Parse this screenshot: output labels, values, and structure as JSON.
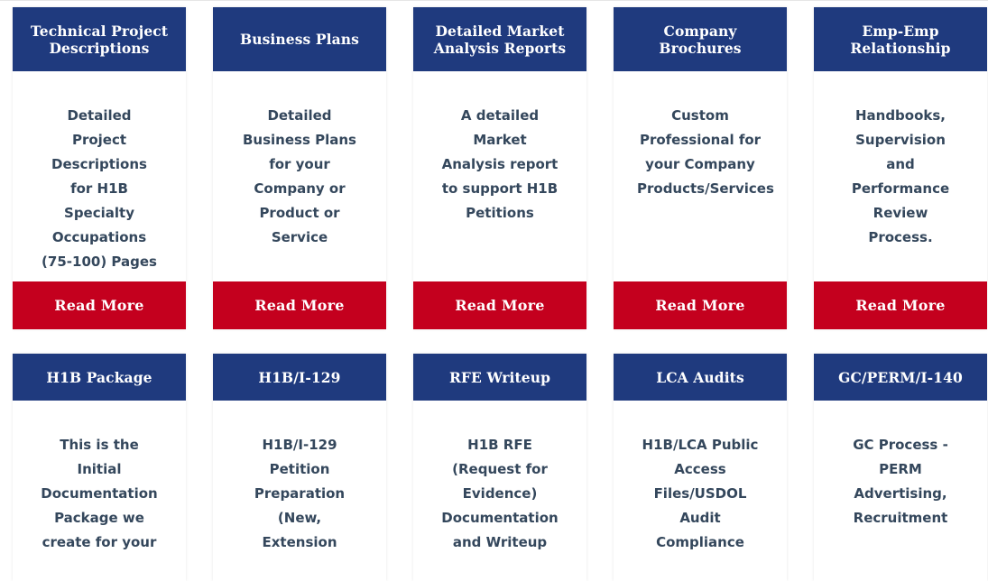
{
  "cards_row1": [
    {
      "title": "Technical Project Descriptions",
      "body": "Detailed Project Descriptions for H1B Specialty Occupations (75-100) Pages",
      "button": "Read More"
    },
    {
      "title": "Business Plans",
      "body": "Detailed Business Plans for your Company or Product or Service",
      "button": "Read More"
    },
    {
      "title": "Detailed Market Analysis Reports",
      "body": "A detailed Market Analysis report to support H1B Petitions",
      "button": "Read More"
    },
    {
      "title": "Company Brochures",
      "body": "Custom Professional for your Company Products/Services",
      "button": "Read More"
    },
    {
      "title": "Emp-Emp Relationship",
      "body": "Handbooks, Supervision and Performance Review Process.",
      "button": "Read More"
    }
  ],
  "cards_row2": [
    {
      "title": "H1B Package",
      "body": "This is the Initial Documentation Package we create for your"
    },
    {
      "title": "H1B/I-129",
      "body": "H1B/I-129 Petition Preparation (New, Extension"
    },
    {
      "title": "RFE Writeup",
      "body": "H1B RFE (Request for Evidence) Documentation and Writeup"
    },
    {
      "title": "LCA Audits",
      "body": "H1B/LCA Public Access Files/USDOL Audit Compliance"
    },
    {
      "title": "GC/PERM/I-140",
      "body": "GC Process - PERM Advertising, Recruitment"
    }
  ]
}
